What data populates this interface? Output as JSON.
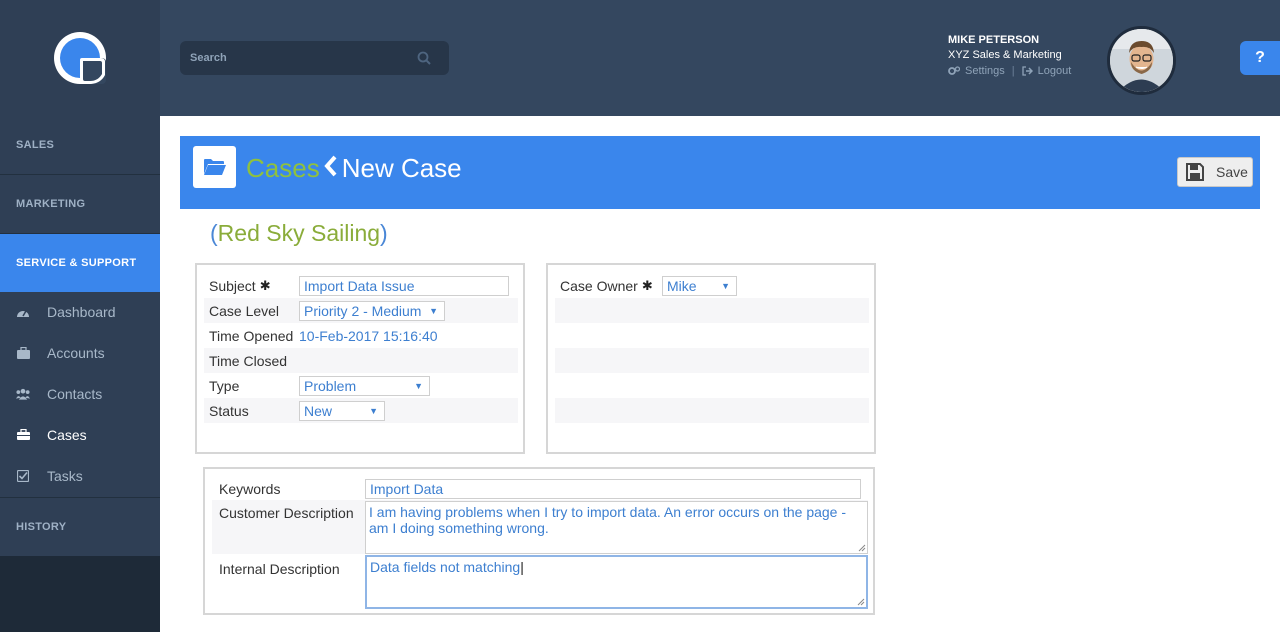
{
  "sidebar": {
    "sections": {
      "sales": "SALES",
      "marketing": "MARKETING",
      "service": "SERVICE & SUPPORT",
      "history": "HISTORY"
    },
    "items": [
      {
        "label": "Dashboard",
        "icon": "dashboard-icon"
      },
      {
        "label": "Accounts",
        "icon": "briefcase-icon"
      },
      {
        "label": "Contacts",
        "icon": "users-icon"
      },
      {
        "label": "Cases",
        "icon": "toolbox-icon"
      },
      {
        "label": "Tasks",
        "icon": "checkbox-icon"
      }
    ],
    "active_item": "Cases"
  },
  "topbar": {
    "search_placeholder": "Search",
    "user": {
      "name": "MIKE PETERSON",
      "company": "XYZ Sales & Marketing",
      "settings": "Settings",
      "logout": "Logout"
    },
    "help": "?"
  },
  "header": {
    "breadcrumb_parent": "Cases",
    "breadcrumb_current": "New Case",
    "save_label": "Save"
  },
  "account": {
    "name": "Red Sky Sailing",
    "open_paren": "(",
    "close_paren": ")"
  },
  "form": {
    "subject": {
      "label": "Subject",
      "value": "Import Data Issue"
    },
    "case_level": {
      "label": "Case Level",
      "value": "Priority 2 - Medium"
    },
    "time_opened": {
      "label": "Time Opened",
      "value": "10-Feb-2017 15:16:40"
    },
    "time_closed": {
      "label": "Time Closed",
      "value": ""
    },
    "type": {
      "label": "Type",
      "value": "Problem"
    },
    "status": {
      "label": "Status",
      "value": "New"
    },
    "case_owner": {
      "label": "Case Owner",
      "value": "Mike"
    },
    "keywords": {
      "label": "Keywords",
      "value": "Import Data"
    },
    "customer_description": {
      "label": "Customer Description",
      "value": "I am having problems when I try to import data. An error occurs on the page - am I doing something wrong."
    },
    "internal_description": {
      "label": "Internal Description",
      "value": "Data fields not matching"
    }
  },
  "colors": {
    "accent": "#3a86ec",
    "sidebar_dark": "#2f3f55",
    "topbar": "#34475f",
    "green": "#8fc13e",
    "value_blue": "#3d7fd0"
  }
}
